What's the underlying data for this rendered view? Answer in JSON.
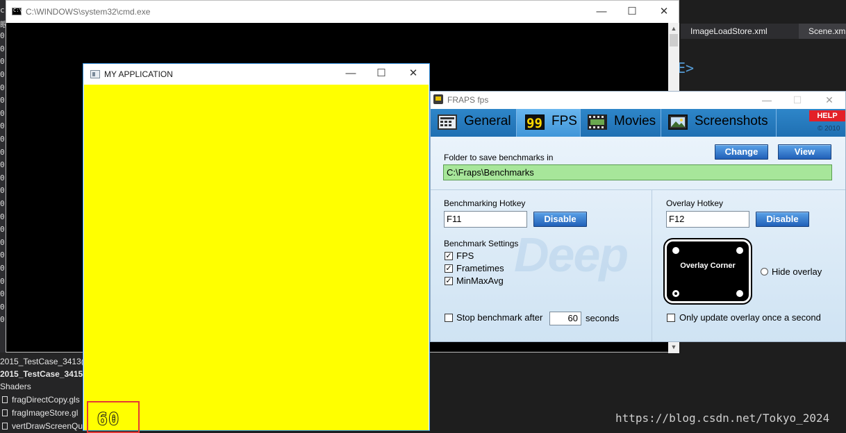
{
  "cmd_window": {
    "title": "C:\\WINDOWS\\system32\\cmd.exe",
    "icon_text": "C:\\.",
    "minimize": "—",
    "maximize": "☐",
    "close": "✕"
  },
  "ide": {
    "left_chars": [
      "c",
      "眼",
      "0",
      "0",
      "0",
      "0",
      "0",
      "0",
      "0",
      "0",
      "0",
      "0",
      "0",
      "0",
      "0",
      "0",
      "0",
      "0",
      "0",
      "0",
      "0",
      "0",
      "0",
      "0",
      "0"
    ],
    "solution_items": [
      {
        "label": "2015_TestCase_3413(F"
      },
      {
        "label": "2015_TestCase_3415("
      },
      {
        "label": "Shaders"
      },
      {
        "label": "fragDirectCopy.gls"
      },
      {
        "label": "fragImageStore.gl"
      },
      {
        "label": "vertDrawScreenQu"
      }
    ],
    "editor_tabs": [
      "ImageLoadStore.xml",
      "Scene.xm"
    ],
    "editor_glyph": "E>"
  },
  "app_window": {
    "title": "MY APPLICATION",
    "canvas_color": "#ffff00",
    "fps_value": "60",
    "minimize": "—",
    "maximize": "☐",
    "close": "✕"
  },
  "fraps": {
    "title": "FRAPS fps",
    "tabs": [
      {
        "label": "General",
        "icon": "calculator-icon",
        "active": false
      },
      {
        "label": "FPS",
        "icon": "fps-99-icon",
        "active": true
      },
      {
        "label": "Movies",
        "icon": "film-icon",
        "active": false
      },
      {
        "label": "Screenshots",
        "icon": "picture-icon",
        "active": false
      }
    ],
    "help_label": "HELP",
    "copyright": "© 2010",
    "folder_label": "Folder to save benchmarks in",
    "folder_value": "C:\\Fraps\\Benchmarks",
    "change_label": "Change",
    "view_label": "View",
    "benchmark_hotkey_label": "Benchmarking Hotkey",
    "benchmark_hotkey_value": "F11",
    "overlay_hotkey_label": "Overlay Hotkey",
    "overlay_hotkey_value": "F12",
    "disable_label": "Disable",
    "benchmark_settings_label": "Benchmark Settings",
    "settings": [
      {
        "label": "FPS",
        "checked": true
      },
      {
        "label": "Frametimes",
        "checked": true
      },
      {
        "label": "MinMaxAvg",
        "checked": true
      }
    ],
    "stop_benchmark_label": "Stop benchmark after",
    "stop_benchmark_checked": false,
    "stop_benchmark_value": "60",
    "seconds_label": "seconds",
    "overlay_corner_label": "Overlay Corner",
    "hide_overlay_label": "Hide overlay",
    "only_update_label": "Only update overlay once a second",
    "only_update_checked": false,
    "accent": "#2e86c9"
  },
  "watermark": "https://blog.csdn.net/Tokyo_2024"
}
